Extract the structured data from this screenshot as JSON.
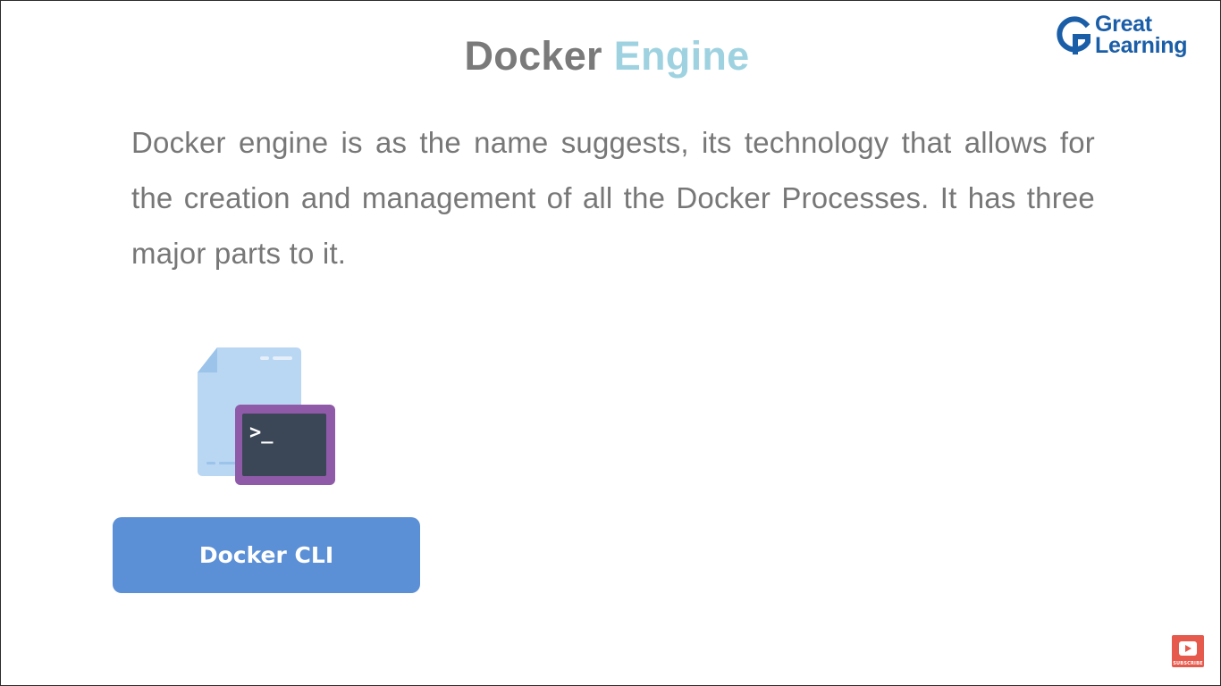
{
  "slide": {
    "title_part1": "Docker",
    "title_part2": "Engine",
    "body": "Docker engine is as the name suggests, its technology that allows for the creation and management of all the Docker Processes. It has three major parts to it."
  },
  "logo": {
    "line1": "Great",
    "line2": "Learning",
    "brand_color": "#1b5ea8"
  },
  "illustration": {
    "icon": "terminal-document-icon",
    "prompt_glyph": ">_"
  },
  "button": {
    "label": "Docker CLI",
    "color": "#5b8fd6"
  },
  "subscribe": {
    "icon": "youtube-play-icon",
    "label": "SUBSCRIBE"
  }
}
